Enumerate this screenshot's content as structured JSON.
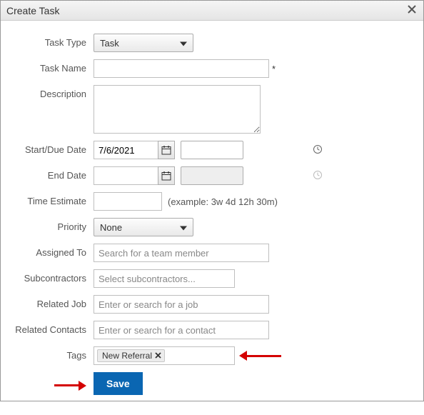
{
  "dialog": {
    "title": "Create Task"
  },
  "labels": {
    "taskType": "Task Type",
    "taskName": "Task Name",
    "description": "Description",
    "startDue": "Start/Due Date",
    "endDate": "End Date",
    "timeEstimate": "Time Estimate",
    "priority": "Priority",
    "assignedTo": "Assigned To",
    "subcontractors": "Subcontractors",
    "relatedJob": "Related Job",
    "relatedContacts": "Related Contacts",
    "tags": "Tags"
  },
  "fields": {
    "taskType": {
      "value": "Task"
    },
    "taskName": {
      "value": "",
      "requiredMark": "*"
    },
    "description": {
      "value": ""
    },
    "startDate": {
      "value": "7/6/2021"
    },
    "startTime": {
      "value": ""
    },
    "endDate": {
      "value": ""
    },
    "endTime": {
      "value": "",
      "disabled": true
    },
    "timeEstimate": {
      "value": "",
      "hint": "(example: 3w 4d 12h 30m)"
    },
    "priority": {
      "value": "None"
    },
    "assignedTo": {
      "value": "",
      "placeholder": "Search for a team member"
    },
    "subcontractors": {
      "value": "",
      "placeholder": "Select subcontractors..."
    },
    "relatedJob": {
      "value": "",
      "placeholder": "Enter or search for a job"
    },
    "relatedContacts": {
      "value": "",
      "placeholder": "Enter or search for a contact"
    },
    "tags": {
      "items": [
        {
          "label": "New Referral"
        }
      ]
    }
  },
  "buttons": {
    "save": "Save"
  }
}
